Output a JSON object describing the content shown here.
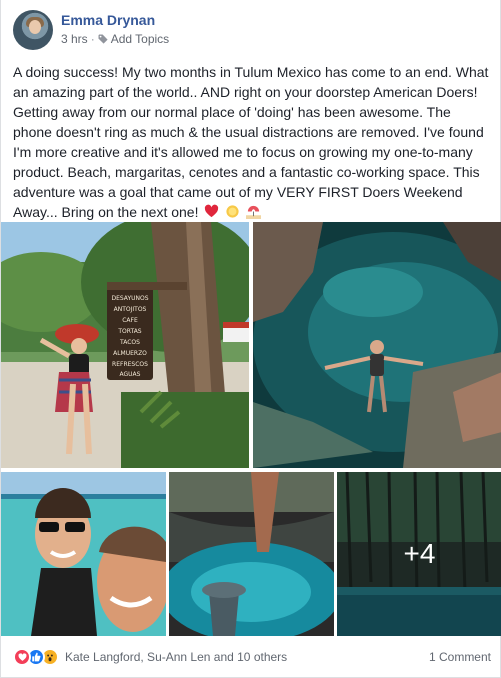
{
  "post": {
    "author": "Emma Drynan",
    "time": "3 hrs",
    "separator": "·",
    "add_topics": "Add Topics",
    "text": "A doing success! My two months in Tulum Mexico has come to an end. What an amazing part of the world.. AND right on your doorstep American Doers! Getting away from our normal place of 'doing' has been awesome. The phone doesn't ring as much & the usual distractions are removed. I've found I'm more creative and it's allowed me to focus on growing my one-to-many product. Beach, margaritas, cenotes and a fantastic co-working space. This adventure was a goal that came out of my VERY FIRST Doers Weekend Away... Bring on the next one!",
    "trailing_emojis": [
      "red-heart-icon",
      "sun-icon",
      "beach-umbrella-icon"
    ]
  },
  "photos": {
    "sign_lines": [
      "DESAYUNOS",
      "ANTOJITOS",
      "CAFE",
      "TORTAS",
      "TACOS",
      "ALMUERZO",
      "REFRESCOS",
      "AGUAS"
    ],
    "more_count": "+4"
  },
  "reactions": {
    "icons": [
      "love-reaction-icon",
      "like-reaction-icon",
      "wow-reaction-icon"
    ],
    "summary": "Kate Langford, Su-Ann Len and 10 others",
    "comments": "1 Comment"
  },
  "colors": {
    "link": "#365899",
    "meta": "#616770",
    "love": "#f33e58",
    "like": "#1877f2",
    "wow": "#f7b125"
  }
}
